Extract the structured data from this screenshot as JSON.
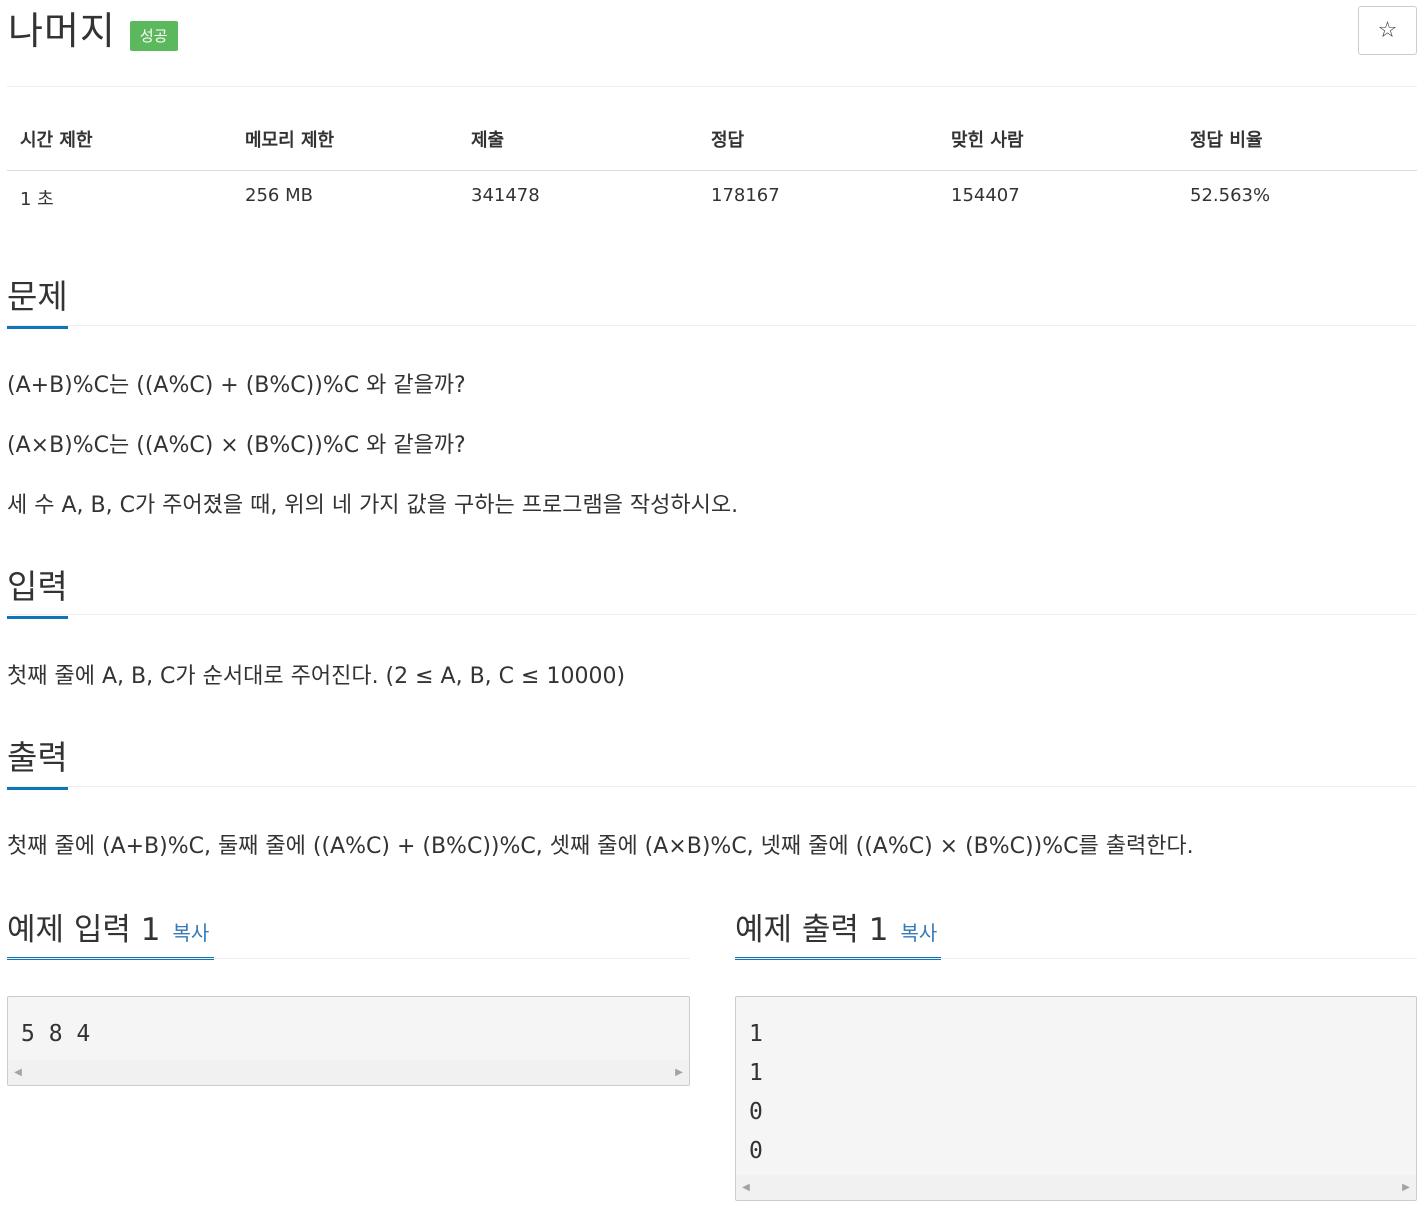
{
  "header": {
    "title": "나머지",
    "status_badge": "성공",
    "star_icon": "☆"
  },
  "info_table": {
    "headers": [
      "시간 제한",
      "메모리 제한",
      "제출",
      "정답",
      "맞힌 사람",
      "정답 비율"
    ],
    "values": [
      "1 초",
      "256 MB",
      "341478",
      "178167",
      "154407",
      "52.563%"
    ]
  },
  "problem": {
    "heading": "문제",
    "lines": [
      "(A+B)%C는 ((A%C) + (B%C))%C 와 같을까?",
      "(A×B)%C는 ((A%C) × (B%C))%C 와 같을까?",
      "세 수 A, B, C가 주어졌을 때, 위의 네 가지 값을 구하는 프로그램을 작성하시오."
    ]
  },
  "input": {
    "heading": "입력",
    "text": "첫째 줄에 A, B, C가 순서대로 주어진다. (2 ≤ A, B, C ≤ 10000)"
  },
  "output": {
    "heading": "출력",
    "text": "첫째 줄에 (A+B)%C, 둘째 줄에 ((A%C) + (B%C))%C, 셋째 줄에 (A×B)%C, 넷째 줄에 ((A%C) × (B%C))%C를 출력한다."
  },
  "sample_input": {
    "heading": "예제 입력 1",
    "copy_label": "복사",
    "content": "5 8 4"
  },
  "sample_output": {
    "heading": "예제 출력 1",
    "copy_label": "복사",
    "content": "1\n1\n0\n0"
  },
  "scrollbar": {
    "left_arrow": "◀",
    "right_arrow": "▶"
  }
}
